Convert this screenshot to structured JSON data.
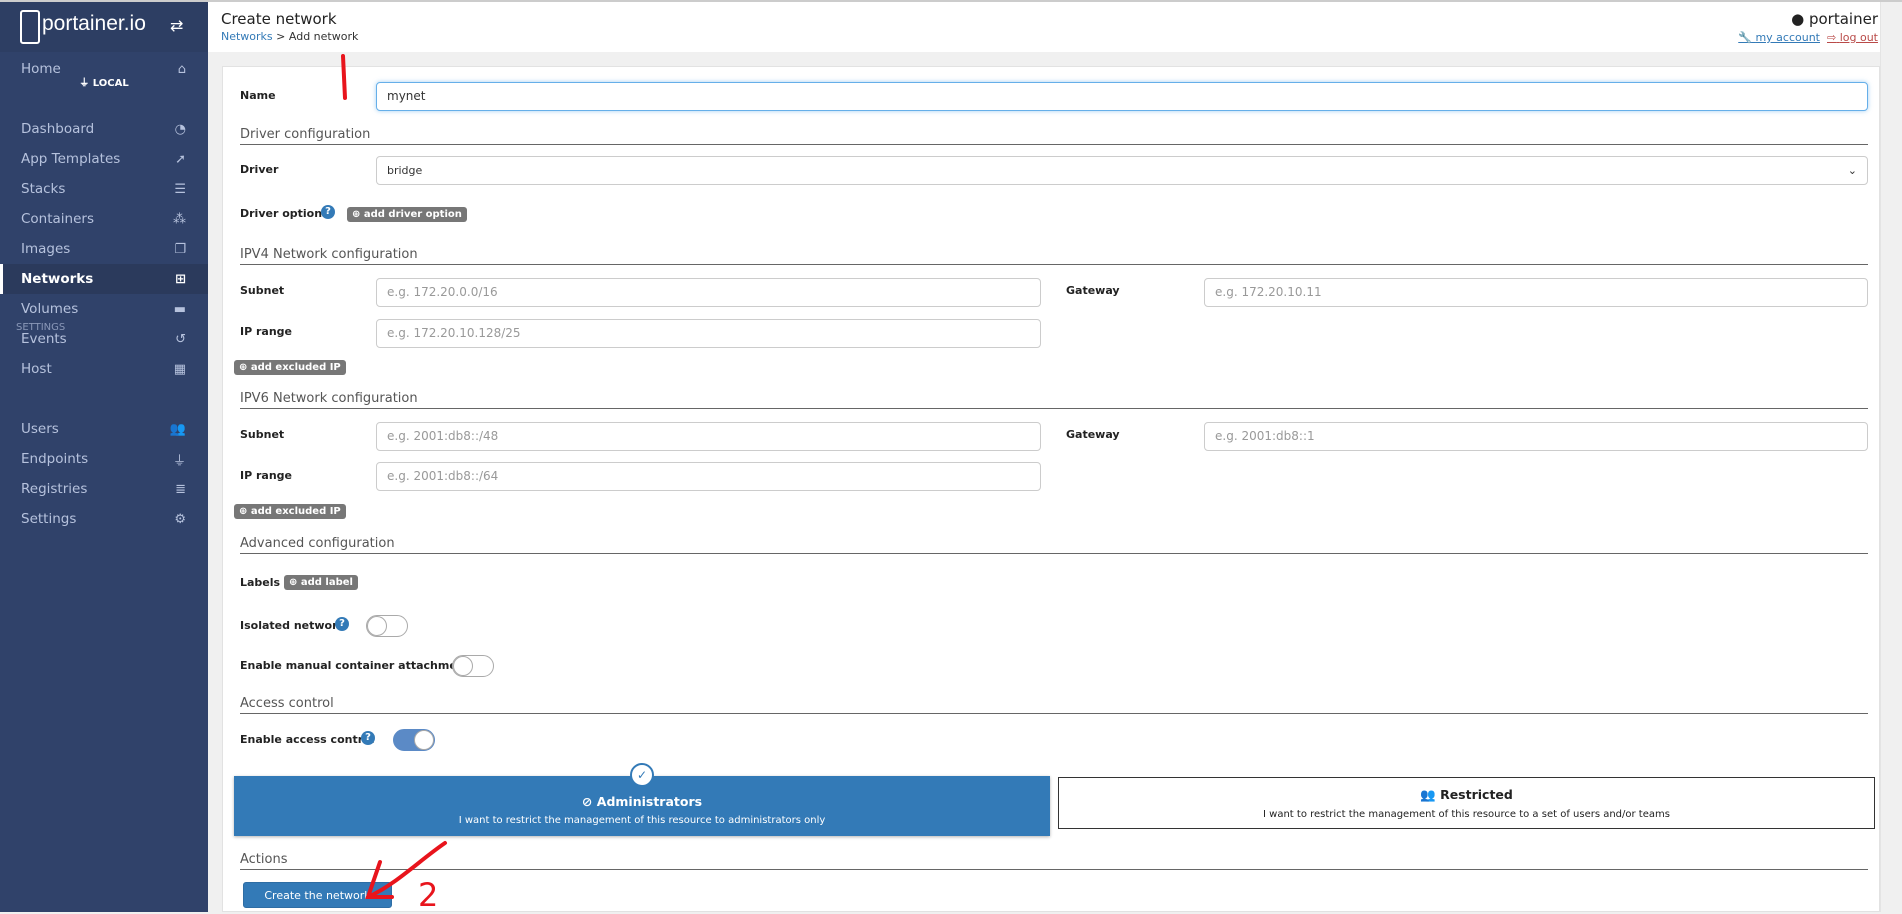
{
  "brand": "portainer.io",
  "sidebar": {
    "endpoint": "LOCAL",
    "settings_section": "SETTINGS",
    "items": [
      {
        "label": "Home",
        "icon": "home-icon",
        "glyph": "⌂"
      },
      {
        "label": "Dashboard",
        "icon": "tachometer-icon",
        "glyph": "◔"
      },
      {
        "label": "App Templates",
        "icon": "rocket-icon",
        "glyph": "➚"
      },
      {
        "label": "Stacks",
        "icon": "list-icon",
        "glyph": "☰"
      },
      {
        "label": "Containers",
        "icon": "cubes-icon",
        "glyph": "⁂"
      },
      {
        "label": "Images",
        "icon": "clone-icon",
        "glyph": "❐"
      },
      {
        "label": "Networks",
        "icon": "sitemap-icon",
        "glyph": "⊞"
      },
      {
        "label": "Volumes",
        "icon": "hdd-icon",
        "glyph": "▬"
      },
      {
        "label": "Events",
        "icon": "history-icon",
        "glyph": "↺"
      },
      {
        "label": "Host",
        "icon": "th-icon",
        "glyph": "▦"
      },
      {
        "label": "Users",
        "icon": "users-icon",
        "glyph": "👥"
      },
      {
        "label": "Endpoints",
        "icon": "plug-icon",
        "glyph": "⏚"
      },
      {
        "label": "Registries",
        "icon": "database-icon",
        "glyph": "≣"
      },
      {
        "label": "Settings",
        "icon": "cogs-icon",
        "glyph": "⚙"
      }
    ]
  },
  "header": {
    "title": "Create network",
    "crumb_link": "Networks",
    "crumb_sep": " > ",
    "crumb_current": "Add network",
    "user": "portainer",
    "my_account": "my account",
    "log_out": "log out"
  },
  "form": {
    "name_label": "Name",
    "name_value": "mynet",
    "driver_section": "Driver configuration",
    "driver_label": "Driver",
    "driver_value": "bridge",
    "driver_options_label": "Driver options",
    "add_driver_option": "add driver option",
    "ipv4_section": "IPV4 Network configuration",
    "ipv6_section": "IPV6 Network configuration",
    "subnet_label": "Subnet",
    "gateway_label": "Gateway",
    "iprange_label": "IP range",
    "ipv4_subnet_ph": "e.g. 172.20.0.0/16",
    "ipv4_gateway_ph": "e.g. 172.20.10.11",
    "ipv4_iprange_ph": "e.g. 172.20.10.128/25",
    "ipv6_subnet_ph": "e.g. 2001:db8::/48",
    "ipv6_gateway_ph": "e.g. 2001:db8::1",
    "ipv6_iprange_ph": "e.g. 2001:db8::/64",
    "add_excluded_ip": "add excluded IP",
    "advanced_section": "Advanced configuration",
    "labels_label": "Labels",
    "add_label": "add label",
    "isolated_label": "Isolated network",
    "isolated_on": false,
    "manual_attach_label": "Enable manual container attachment",
    "manual_attach_on": false,
    "access_section": "Access control",
    "access_label": "Enable access control",
    "access_on": true,
    "admin_title": "Administrators",
    "admin_desc": "I want to restrict the management of this resource to administrators only",
    "restricted_title": "Restricted",
    "restricted_desc": "I want to restrict the management of this resource to a set of users and/or teams",
    "actions_section": "Actions",
    "create_button": "Create the network"
  },
  "annotations": {
    "step2": "2"
  },
  "colors": {
    "sidebar": "#30426a",
    "primary": "#337ab7",
    "annotation": "#e8141c"
  }
}
